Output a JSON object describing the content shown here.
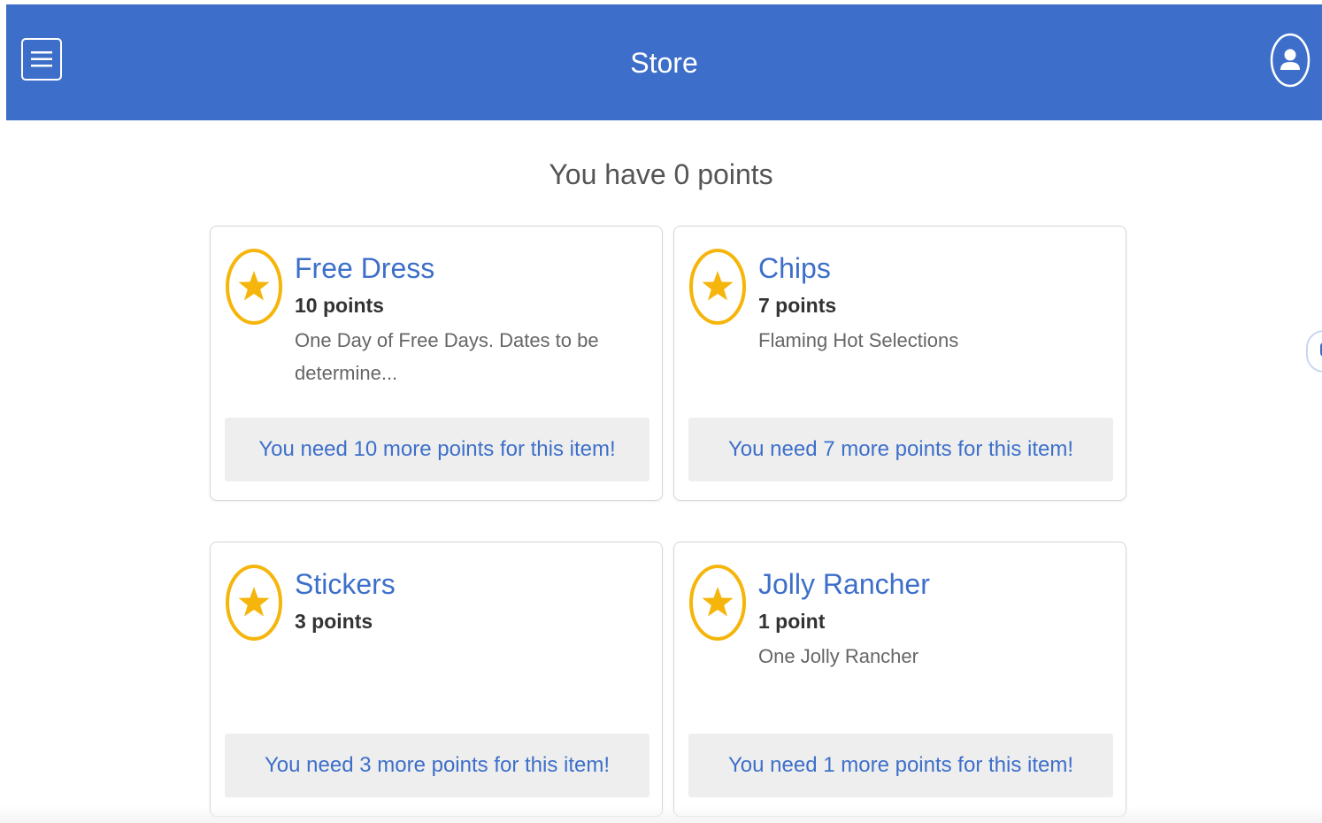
{
  "header": {
    "title": "Store",
    "menu_icon": "hamburger-menu-icon",
    "profile_icon": "user-icon",
    "background_color": "#3d6fca"
  },
  "summary": {
    "text": "You have 0 points"
  },
  "colors": {
    "accent": "#3d6fca",
    "star": "#f5b50a",
    "banner_bg": "#eeeeee"
  },
  "items": [
    {
      "title": "Free Dress",
      "points": "10 points",
      "description": "One Day of Free Days. Dates to be determine...",
      "need": "You need 10 more points for this item!"
    },
    {
      "title": "Chips",
      "points": "7 points",
      "description": "Flaming Hot Selections",
      "need": "You need 7 more points for this item!"
    },
    {
      "title": "Stickers",
      "points": "3 points",
      "description": "",
      "need": "You need 3 more points for this item!"
    },
    {
      "title": "Jolly Rancher",
      "points": "1 point",
      "description": "One Jolly Rancher",
      "need": "You need 1 more points for this item!"
    }
  ]
}
